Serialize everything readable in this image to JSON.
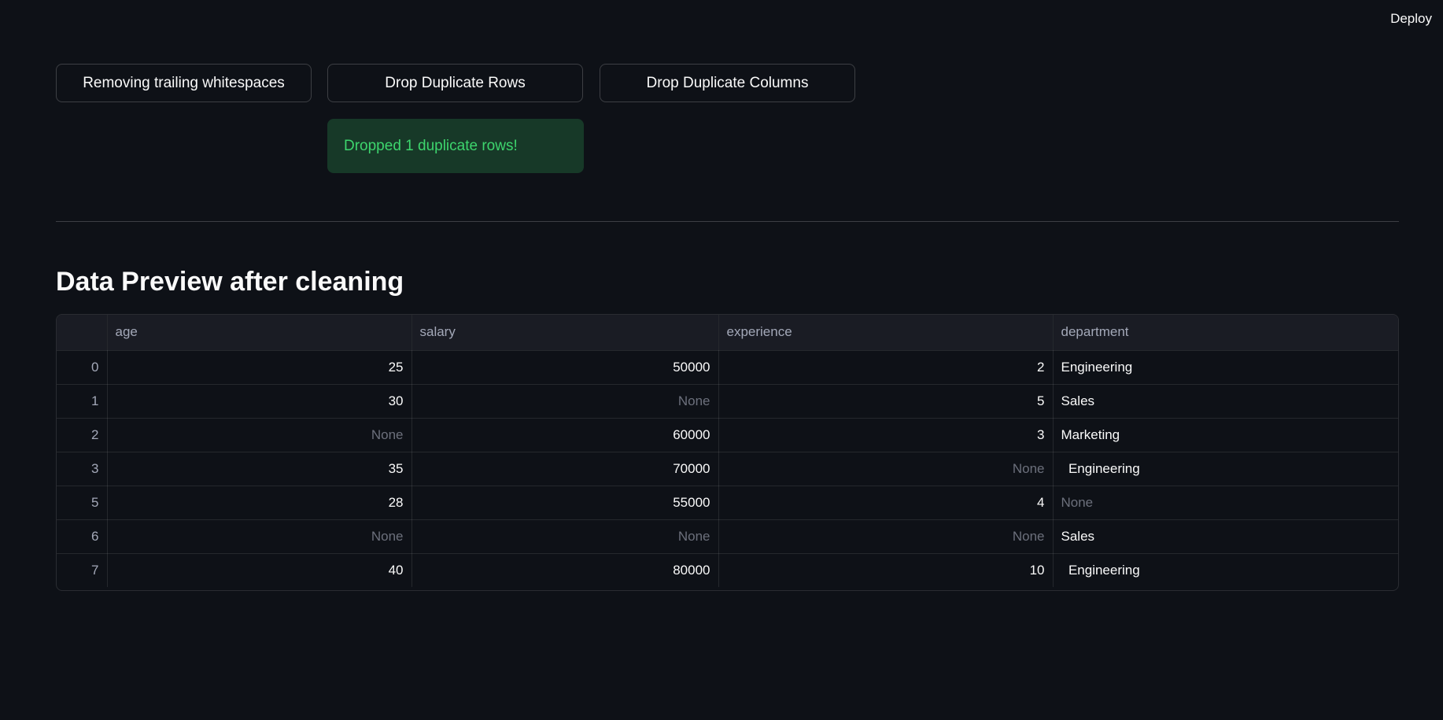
{
  "header": {
    "deploy_label": "Deploy"
  },
  "actions": {
    "trim_label": "Removing trailing whitespaces",
    "drop_rows_label": "Drop Duplicate Rows",
    "drop_cols_label": "Drop Duplicate Columns"
  },
  "alert": {
    "message": "Dropped 1 duplicate rows!"
  },
  "section": {
    "title": "Data Preview after cleaning"
  },
  "table": {
    "columns": [
      "",
      "age",
      "salary",
      "experience",
      "department"
    ],
    "rows": [
      [
        "0",
        "25",
        "50000",
        "2",
        "Engineering"
      ],
      [
        "1",
        "30",
        "None",
        "5",
        "Sales"
      ],
      [
        "2",
        "None",
        "60000",
        "3",
        "Marketing"
      ],
      [
        "3",
        "35",
        "70000",
        "None",
        "  Engineering"
      ],
      [
        "5",
        "28",
        "55000",
        "4",
        "None"
      ],
      [
        "6",
        "None",
        "None",
        "None",
        "Sales"
      ],
      [
        "7",
        "40",
        "80000",
        "10",
        "  Engineering"
      ]
    ]
  },
  "colors": {
    "background": "#0e1117",
    "success_bg": "#173928",
    "success_text": "#3dd56d",
    "null_text": "#6c707c"
  }
}
